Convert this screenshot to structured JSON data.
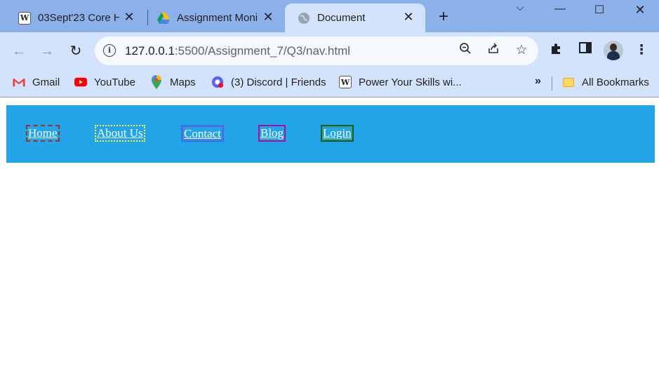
{
  "browser": {
    "tabs": [
      {
        "title": "03Sept'23 Core H",
        "active": false
      },
      {
        "title": "Assignment Moni",
        "active": false
      },
      {
        "title": "Document",
        "active": true
      }
    ],
    "url": {
      "host": "127.0.0.1",
      "rest": ":5500/Assignment_7/Q3/nav.html"
    },
    "bookmarks": [
      {
        "label": "Gmail",
        "icon": "gmail-icon"
      },
      {
        "label": "YouTube",
        "icon": "youtube-icon"
      },
      {
        "label": "Maps",
        "icon": "maps-icon"
      },
      {
        "label": "(3) Discord | Friends",
        "icon": "discord-icon"
      },
      {
        "label": "Power Your Skills wi...",
        "icon": "w-icon"
      }
    ],
    "all_bookmarks": "All Bookmarks"
  },
  "page": {
    "nav": [
      {
        "label": "Home",
        "border": "#a32d2d"
      },
      {
        "label": "About Us",
        "border": "#ffff3c"
      },
      {
        "label": "Contact",
        "border": "#5a4fe0"
      },
      {
        "label": "Blog",
        "border": "#a4129e"
      },
      {
        "label": "Login",
        "border": "#0b5a1c"
      }
    ],
    "nav_background": "#21a4e8"
  }
}
